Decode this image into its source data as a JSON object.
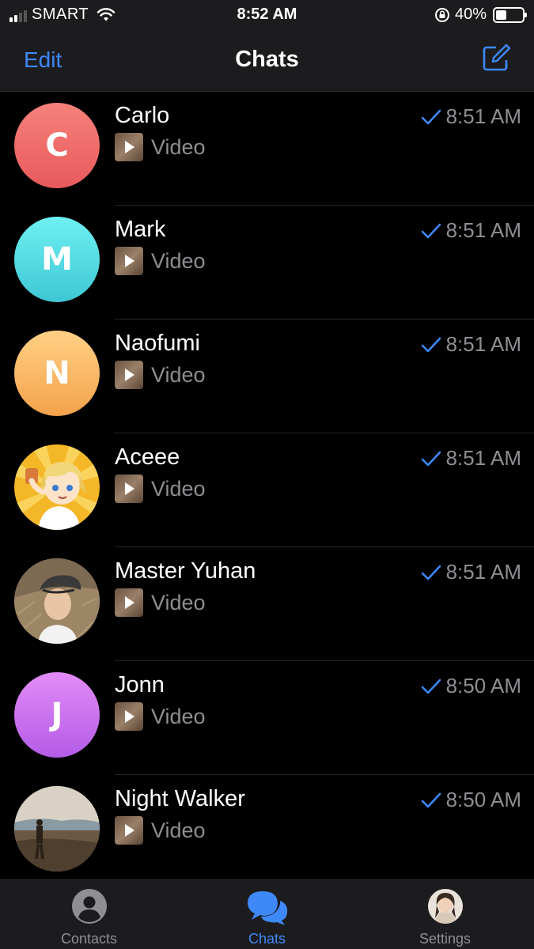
{
  "status_bar": {
    "carrier": "SMART",
    "time": "8:52 AM",
    "battery": "40%",
    "battery_level": 0.4,
    "signal_bars": 2
  },
  "nav": {
    "edit_label": "Edit",
    "title": "Chats",
    "compose_icon": "compose-icon"
  },
  "chats": [
    {
      "name": "Carlo",
      "time": "8:51 AM",
      "preview": "Video",
      "initial": "C",
      "avatar_colors": [
        "#f5817a",
        "#e85a5c"
      ]
    },
    {
      "name": "Mark",
      "time": "8:51 AM",
      "preview": "Video",
      "initial": "M",
      "avatar_colors": [
        "#6ff0f3",
        "#3ec7d4"
      ]
    },
    {
      "name": "Naofumi",
      "time": "8:51 AM",
      "preview": "Video",
      "initial": "N",
      "avatar_colors": [
        "#ffd085",
        "#f4a24a"
      ]
    },
    {
      "name": "Aceee",
      "time": "8:51 AM",
      "preview": "Video",
      "initial": "",
      "avatar_colors": [
        "#f7c23b",
        "#e8a612"
      ]
    },
    {
      "name": "Master Yuhan",
      "time": "8:51 AM",
      "preview": "Video",
      "initial": "",
      "avatar_colors": [
        "#b8a17f",
        "#6e5d45"
      ]
    },
    {
      "name": "Jonn",
      "time": "8:50 AM",
      "preview": "Video",
      "initial": "J",
      "avatar_colors": [
        "#e28bf7",
        "#b45ce6"
      ]
    },
    {
      "name": "Night Walker",
      "time": "8:50 AM",
      "preview": "Video",
      "initial": "",
      "avatar_colors": [
        "#c9b89a",
        "#5f5040"
      ]
    }
  ],
  "tabs": {
    "contacts": "Contacts",
    "chats": "Chats",
    "settings": "Settings"
  },
  "colors": {
    "accent": "#3e88f7",
    "background": "#000000",
    "bar_background": "#1c1c1e",
    "secondary_text": "#8e8e93"
  }
}
